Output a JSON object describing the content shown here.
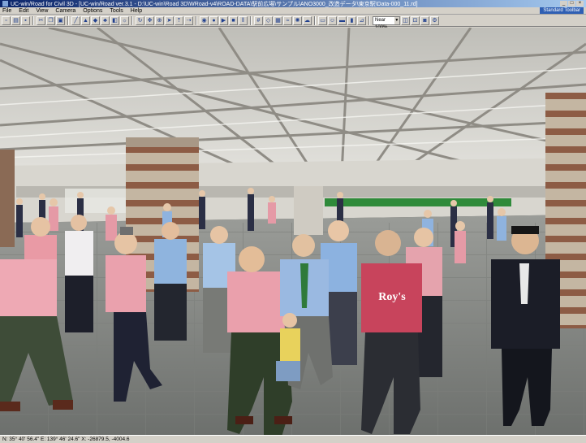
{
  "window": {
    "title": "UC-win/Road for Civil 3D - [UC-win/Road ver.3.1 - D:\\UC-win\\Road 3D\\WRoad-v4\\ROAD-DATA\\駅前広場\\サンプル\\ANO3000_改造データ\\東京駅\\Data-000_11.rd]",
    "controls": [
      "_",
      "□",
      "×"
    ]
  },
  "menu": {
    "items": [
      "File",
      "Edit",
      "View",
      "Camera",
      "Options",
      "Tools",
      "Help"
    ],
    "badge": "Standard Toolbar"
  },
  "toolbar": {
    "zoom_value": "Near 100%"
  },
  "status": {
    "coords": "N: 35° 40' 56.4\"  E: 139° 46' 24.6\"  X: -26879.5, -4004.6"
  },
  "scene": {
    "description_icon": "3d-station-concourse",
    "pillar_colors": [
      "#c4b6a2",
      "#8d5c45"
    ],
    "floor_color": "#8a8e8c",
    "ceiling_color": "#d9d9d5",
    "sign_color": "#2f8a3a",
    "sign_text": "Roy's"
  }
}
